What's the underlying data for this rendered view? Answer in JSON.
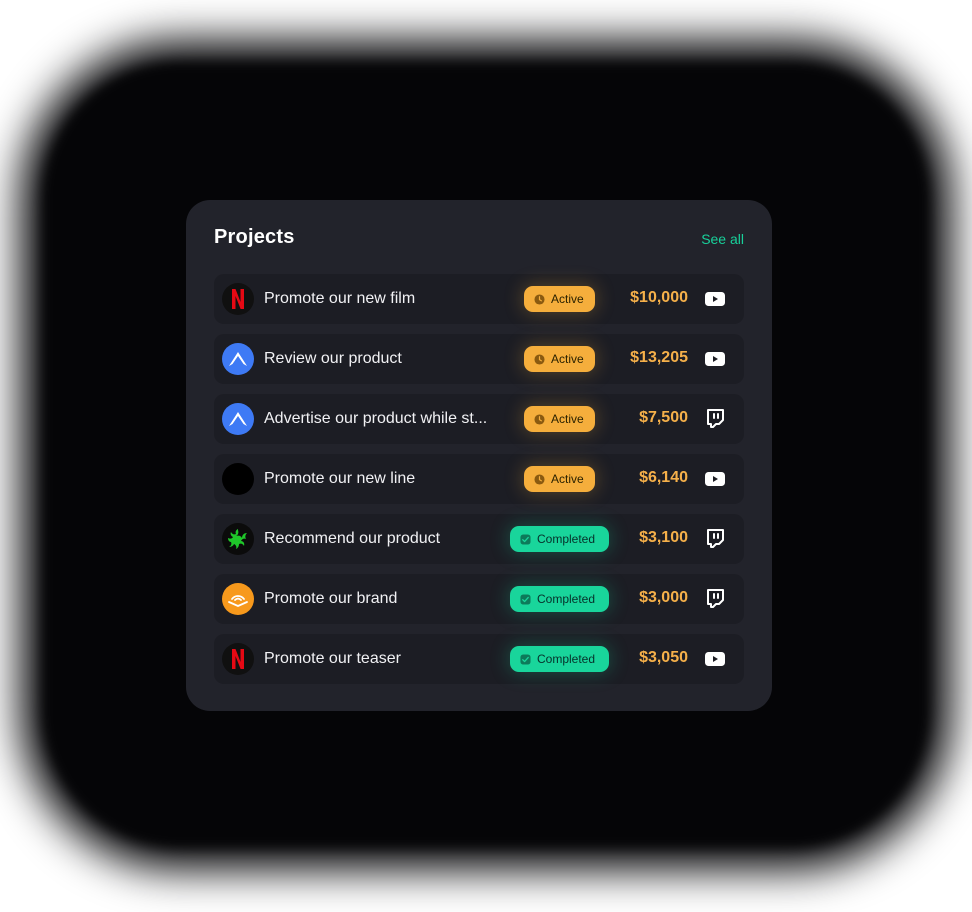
{
  "header": {
    "title": "Projects",
    "see_all_label": "See all"
  },
  "colors": {
    "card_bg": "#22232b",
    "row_bg": "#1c1d24",
    "accent_green": "#18d09a",
    "active_badge": "#f5ae3c",
    "completed_badge": "#19d59b",
    "amount": "#f5b04a"
  },
  "projects": [
    {
      "brand_icon": "netflix-logo-icon",
      "title": "Promote our new film",
      "status": "Active",
      "amount": "$10,000",
      "platform_icon": "youtube-icon"
    },
    {
      "brand_icon": "nordvpn-logo-icon",
      "title": "Review our product",
      "status": "Active",
      "amount": "$13,205",
      "platform_icon": "youtube-icon"
    },
    {
      "brand_icon": "nordvpn-logo-icon",
      "title": "Advertise our product while st...",
      "status": "Active",
      "amount": "$7,500",
      "platform_icon": "twitch-icon"
    },
    {
      "brand_icon": "nike-logo-icon",
      "title": "Promote our new line",
      "status": "Active",
      "amount": "$6,140",
      "platform_icon": "youtube-icon"
    },
    {
      "brand_icon": "razer-logo-icon",
      "title": "Recommend our product",
      "status": "Completed",
      "amount": "$3,100",
      "platform_icon": "twitch-icon"
    },
    {
      "brand_icon": "audible-logo-icon",
      "title": "Promote our brand",
      "status": "Completed",
      "amount": "$3,000",
      "platform_icon": "twitch-icon"
    },
    {
      "brand_icon": "netflix-logo-icon",
      "title": "Promote our teaser",
      "status": "Completed",
      "amount": "$3,050",
      "platform_icon": "youtube-icon"
    }
  ]
}
